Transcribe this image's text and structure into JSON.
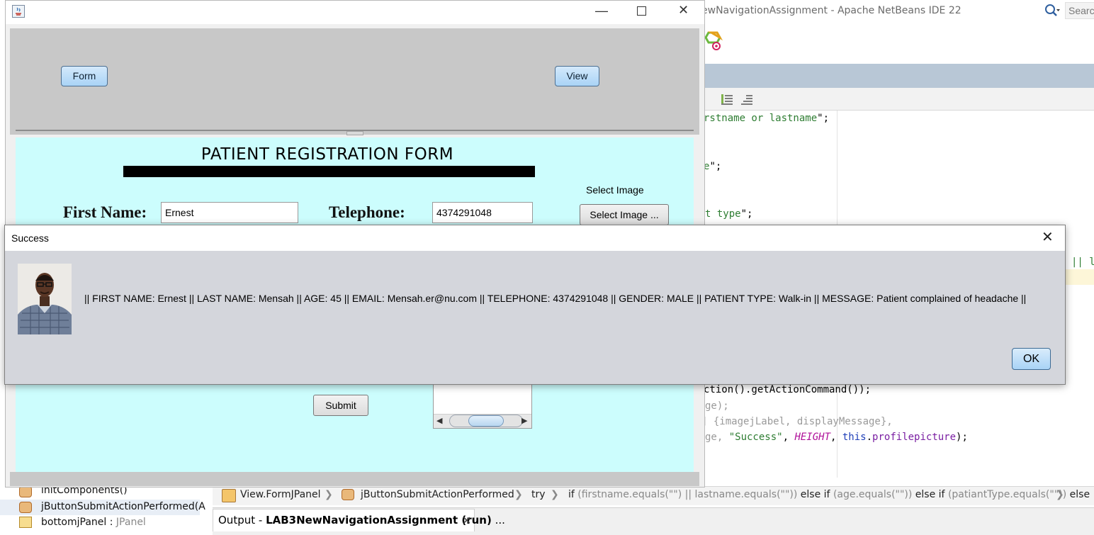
{
  "ide": {
    "title": "ewNavigationAssignment - Apache NetBeans IDE 22",
    "search_placeholder": "Searc",
    "code": {
      "l1_str": "rstname or lastname",
      "l1_end": "\";",
      "l2_str": "e",
      "l2_end": "\";",
      "l3_str": "t type",
      "l3_end": "\";",
      "l4": "|| l",
      "l5": "ction().getActionCommand());",
      "l6": "ge);",
      "l7": "] {imagejLabel, displayMessage},",
      "l8_a": "ge, ",
      "l8_b": "\"Success\"",
      "l8_c": ", ",
      "l8_d": "HEIGHT",
      "l8_e": ", ",
      "l8_f": "this",
      "l8_g": ".",
      "l8_h": "profilepicture",
      "l8_i": ");"
    },
    "breadcrumb": {
      "item1": "View.FormJPanel",
      "item2": "jButtonSubmitActionPerformed",
      "item3": "try",
      "if1": "if",
      "cond1": "(firstname.equals(\"\") || lastname.equals(\"\"))",
      "else1": "else if",
      "cond2": "(age.equals(\"\"))",
      "else2": "else if",
      "cond3": "(patiantType.equals(\"\"))",
      "else3": "else"
    },
    "output_tab": {
      "prefix": "Output - ",
      "project": "LAB3NewNavigationAssignment (run)",
      "ellipsis": " ..."
    },
    "navigator": {
      "item1": "initComponents()",
      "item2": "jButtonSubmitActionPerformed(A",
      "item3_name": "bottomjPanel : ",
      "item3_type": "JPanel"
    }
  },
  "app": {
    "form_button": "Form",
    "view_button": "View",
    "form_title": "PATIENT REGISTRATION FORM",
    "first_name_label": "First Name:",
    "first_name_value": "Ernest",
    "telephone_label": "Telephone:",
    "telephone_value": "4374291048",
    "select_image_label": "Select Image",
    "select_image_button": "Select Image ...",
    "submit_button": "Submit"
  },
  "dialog": {
    "title": "Success",
    "message": "|| FIRST NAME: Ernest || LAST NAME: Mensah || AGE: 45 || EMAIL: Mensah.er@nu.com || TELEPHONE: 4374291048 || GENDER: MALE || PATIENT TYPE: Walk-in || MESSAGE: Patient complained of headache  ||",
    "ok_button": "OK"
  },
  "colors": {
    "form_background": "#ccfdfd",
    "top_panel": "#c8c8c8",
    "dialog_background": "#d4d6dc",
    "ide_tabbar": "#b8c7d6",
    "accent_button": "#a9d3f6"
  }
}
